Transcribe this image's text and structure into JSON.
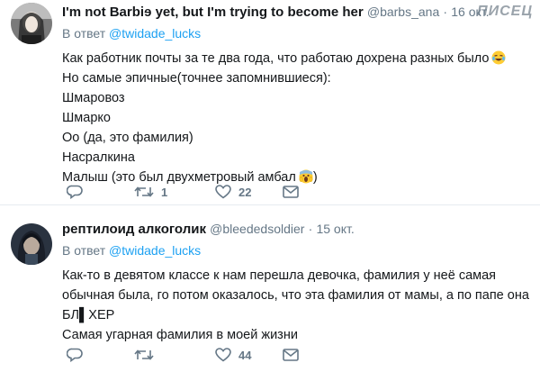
{
  "watermark": "ПИСЕЦ",
  "tweets": [
    {
      "name": "I'm not Barbiɘ yet, but I'm trying to become her",
      "handle": "@barbs_ana",
      "date": "16 окт.",
      "reply_prefix": "В ответ",
      "reply_to": "@twidade_lucks",
      "lines": [
        "Как работник почты за те два года, что работаю дохрена разных было",
        "Но самые эпичные(точнее запомнившиеся):",
        "Шмаровоз",
        "Шмарко",
        "Оо (да, это фамилия)",
        "Насралкина",
        "Малыш (это был двухметровый амбал"
      ],
      "retweets": "1",
      "likes": "22"
    },
    {
      "name": "рептилоид алкоголик",
      "handle": "@bleededsoldier",
      "date": "15 окт.",
      "reply_prefix": "В ответ",
      "reply_to": "@twidade_lucks",
      "lines": [
        "Как-то в девятом классе к нам перешла девочка, фамилия у неё самая",
        "обычная была, го потом оказалось, что эта фамилия от мамы, а по папе она",
        "БЛ▌ХЕР",
        "Самая угарная фамилия в моей жизни"
      ],
      "retweets": "",
      "likes": "44"
    }
  ],
  "icons": {
    "reply": "reply-icon",
    "retweet": "retweet-icon",
    "like": "heart-icon",
    "dm": "envelope-icon",
    "emoji_laugh": "crying-laughing-emoji",
    "emoji_scream": "screaming-emoji"
  },
  "colors": {
    "link": "#1da1f2",
    "meta": "#657786",
    "text": "#14171a"
  }
}
